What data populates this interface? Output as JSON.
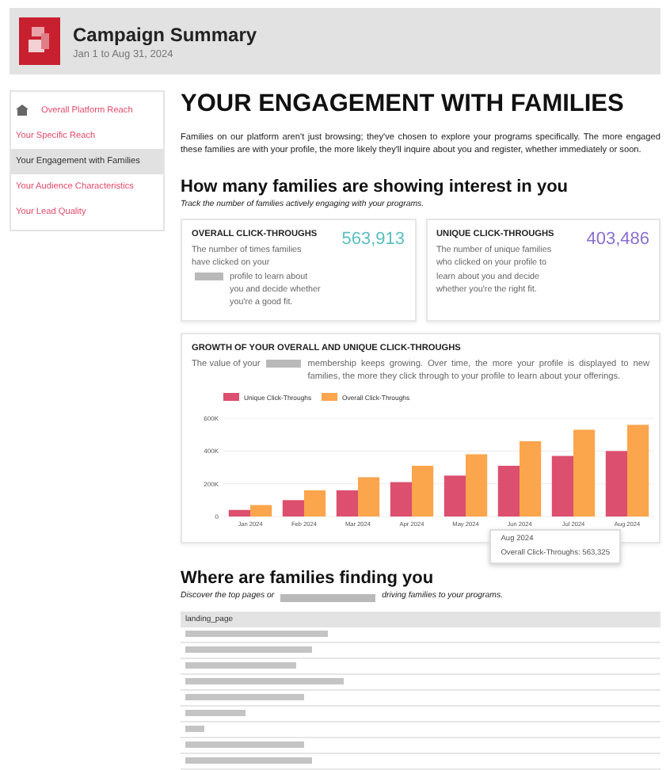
{
  "header": {
    "title": "Campaign Summary",
    "subtitle": "Jan 1 to Aug 31, 2024"
  },
  "sidebar": {
    "items": [
      {
        "label": "Overall Platform Reach",
        "kind": "home",
        "selected": false
      },
      {
        "label": "Your Specific Reach",
        "kind": "link",
        "selected": false
      },
      {
        "label": "Your Engagement with Families",
        "kind": "link",
        "selected": true
      },
      {
        "label": "Your Audience Characteristics",
        "kind": "link",
        "selected": false
      },
      {
        "label": "Your Lead Quality",
        "kind": "link",
        "selected": false
      }
    ]
  },
  "main": {
    "title": "YOUR ENGAGEMENT WITH FAMILIES",
    "intro": "Families on our platform aren't just browsing; they've chosen to explore your programs specifically. The more engaged these families are with your profile, the more likely they'll inquire about you and register, whether immediately or soon.",
    "section1": {
      "title": "How many families are showing interest in you",
      "subtitle": "Track the number of families actively engaging with your programs."
    },
    "stats": [
      {
        "title": "OVERALL CLICK-THROUGHS",
        "value": "563,913",
        "color": "#5bbfc0",
        "text_before": "The number of times families have clicked on your",
        "text_after": "profile to learn about you and decide whether you're a good fit."
      },
      {
        "title": "UNIQUE CLICK-THROUGHS",
        "value": "403,486",
        "color": "#8a6fd0",
        "text_before": "The number of unique families who clicked on your profile to learn about you and decide whether you're the right fit."
      }
    ],
    "growth": {
      "title": "GROWTH OF YOUR OVERALL AND UNIQUE CLICK-THROUGHS",
      "text_before": "The value of your",
      "text_after": "membership keeps growing. Over time, the more your profile is displayed to new families, the more they click through to your profile to learn about your offerings.",
      "chart_data": {
        "type": "bar",
        "categories": [
          "Jan 2024",
          "Feb 2024",
          "Mar 2024",
          "Apr 2024",
          "May 2024",
          "Jun 2024",
          "Jul 2024",
          "Aug 2024"
        ],
        "series": [
          {
            "name": "Unique Click-Throughs",
            "color": "#dc4f6e",
            "values": [
              40000,
              100000,
              160000,
              210000,
              250000,
              310000,
              370000,
              400000
            ]
          },
          {
            "name": "Overall Click-Throughs",
            "color": "#fba54d",
            "values": [
              70000,
              160000,
              240000,
              310000,
              380000,
              460000,
              530000,
              560000
            ]
          }
        ],
        "legend": "top",
        "ylim": [
          0,
          600000
        ],
        "yticks": [
          {
            "value": 0,
            "label": "0"
          },
          {
            "value": 200000,
            "label": "200K"
          },
          {
            "value": 400000,
            "label": "400K"
          },
          {
            "value": 600000,
            "label": "600K"
          }
        ]
      },
      "tooltip": {
        "title": "Aug 2024",
        "text": "Overall Click-Throughs: 563,325"
      }
    },
    "section2": {
      "title": "Where are families finding you",
      "text_before": "Discover the top pages or",
      "text_after": "driving families to your programs."
    },
    "table": {
      "columns": [
        "landing_page"
      ]
    }
  }
}
